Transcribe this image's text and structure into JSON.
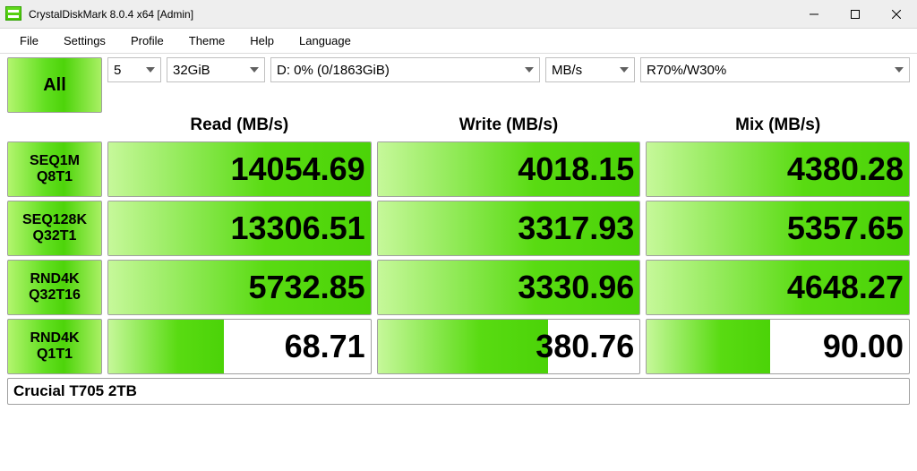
{
  "title": "CrystalDiskMark 8.0.4 x64 [Admin]",
  "menus": [
    "File",
    "Settings",
    "Profile",
    "Theme",
    "Help",
    "Language"
  ],
  "all_label": "All",
  "controls": {
    "loops": "5",
    "size": "32GiB",
    "target": "D: 0% (0/1863GiB)",
    "unit": "MB/s",
    "mix": "R70%/W30%"
  },
  "headers": {
    "read": "Read (MB/s)",
    "write": "Write (MB/s)",
    "mix": "Mix (MB/s)"
  },
  "tests": [
    {
      "name": "SEQ1M\nQ8T1",
      "read": "14054.69",
      "write": "4018.15",
      "mix": "4380.28",
      "read_pct": 100,
      "write_pct": 100,
      "mix_pct": 100
    },
    {
      "name": "SEQ128K\nQ32T1",
      "read": "13306.51",
      "write": "3317.93",
      "mix": "5357.65",
      "read_pct": 100,
      "write_pct": 100,
      "mix_pct": 100
    },
    {
      "name": "RND4K\nQ32T16",
      "read": "5732.85",
      "write": "3330.96",
      "mix": "4648.27",
      "read_pct": 100,
      "write_pct": 100,
      "mix_pct": 100
    },
    {
      "name": "RND4K\nQ1T1",
      "read": "68.71",
      "write": "380.76",
      "mix": "90.00",
      "read_pct": 44,
      "write_pct": 65,
      "mix_pct": 47
    }
  ],
  "status": "Crucial T705 2TB"
}
